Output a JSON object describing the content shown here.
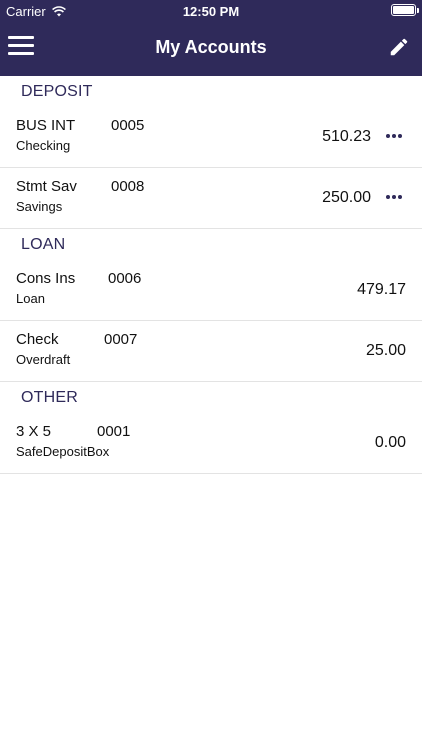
{
  "status_bar": {
    "carrier": "Carrier",
    "time": "12:50 PM"
  },
  "header": {
    "title": "My Accounts"
  },
  "icons": {
    "menu": "hamburger-menu-icon",
    "edit": "pencil-icon",
    "more": "more-horizontal-icon",
    "wifi": "wifi-icon",
    "battery": "battery-icon"
  },
  "colors": {
    "header_bg": "#2f2a5a",
    "accent": "#2f2a5a",
    "divider": "#e3e3e3"
  },
  "sections": [
    {
      "title": "DEPOSIT",
      "accounts": [
        {
          "name": "BUS INT",
          "number": "0005",
          "type": "Checking",
          "amount": "510.23",
          "has_more": true
        },
        {
          "name": "Stmt Sav",
          "number": "0008",
          "type": "Savings",
          "amount": "250.00",
          "has_more": true
        }
      ]
    },
    {
      "title": "LOAN",
      "accounts": [
        {
          "name": "Cons Ins",
          "number": "0006",
          "type": "Loan",
          "amount": "479.17",
          "has_more": false
        },
        {
          "name": "Check",
          "number": "0007",
          "type": "Overdraft",
          "amount": "25.00",
          "has_more": false
        }
      ]
    },
    {
      "title": "OTHER",
      "accounts": [
        {
          "name": "3 X 5",
          "number": "0001",
          "type": "SafeDepositBox",
          "amount": "0.00",
          "has_more": false
        }
      ]
    }
  ]
}
